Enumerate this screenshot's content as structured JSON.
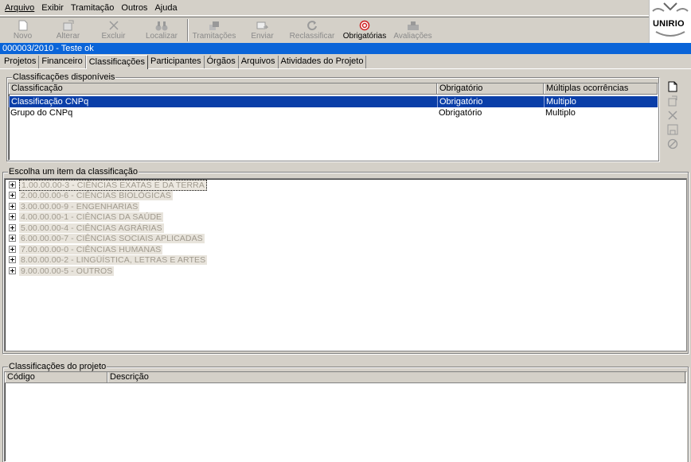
{
  "menu": [
    "Arquivo",
    "Exibir",
    "Tramitação",
    "Outros",
    "Ajuda"
  ],
  "toolbar": [
    {
      "label": "Novo",
      "icon": "new-document-icon",
      "enabled": false
    },
    {
      "label": "Alterar",
      "icon": "edit-icon",
      "enabled": false
    },
    {
      "label": "Excluir",
      "icon": "delete-x-icon",
      "enabled": false
    },
    {
      "label": "Localizar",
      "icon": "binoculars-icon",
      "enabled": false
    },
    {
      "label": "Tramitações",
      "icon": "tramitacoes-icon",
      "enabled": false
    },
    {
      "label": "Enviar",
      "icon": "send-icon",
      "enabled": false
    },
    {
      "label": "Reclassificar",
      "icon": "refresh-icon",
      "enabled": false
    },
    {
      "label": "Obrigatórias",
      "icon": "target-icon",
      "enabled": true
    },
    {
      "label": "Avaliações",
      "icon": "evaluation-icon",
      "enabled": false
    }
  ],
  "logo_text": "UNIRIO",
  "window_title": "000003/2010 - Teste ok",
  "tabs": [
    "Projetos",
    "Financeiro",
    "Classificações",
    "Participantes",
    "Órgãos",
    "Arquivos",
    "Atividades do Projeto"
  ],
  "selected_tab": "Classificações",
  "available": {
    "legend": "Classificações disponíveis",
    "columns": [
      "Classificação",
      "Obrigatório",
      "Múltiplas ocorrências"
    ],
    "rows": [
      [
        "Classificação CNPq",
        "Obrigatório",
        "Multiplo"
      ],
      [
        "Grupo do CNPq",
        "Obrigatório",
        "Multiplo"
      ]
    ]
  },
  "tree": {
    "legend": "Escolha um item da classificação",
    "items": [
      "1.00.00.00-3 - CIÊNCIAS EXATAS E DA TERRA",
      "2.00.00.00-6 - CIÊNCIAS BIOLÓGICAS",
      "3.00.00.00-9 - ENGENHARIAS",
      "4.00.00.00-1 - CIÊNCIAS DA SAÚDE",
      "5.00.00.00-4 - CIÊNCIAS AGRÁRIAS",
      "6.00.00.00-7 - CIÊNCIAS SOCIAIS APLICADAS",
      "7.00.00.00-0 - CIÊNCIAS HUMANAS",
      "8.00.00.00-2 - LINGÜÍSTICA, LETRAS E ARTES",
      "9.00.00.00-5 - OUTROS"
    ]
  },
  "project": {
    "legend": "Classificações do projeto",
    "columns": [
      "Código",
      "Descrição"
    ]
  },
  "colors": {
    "selection": "#0a3ea8",
    "titlebar": "#0a64d8",
    "face": "#d4d0c8"
  }
}
